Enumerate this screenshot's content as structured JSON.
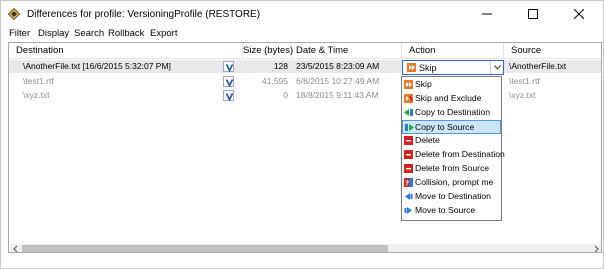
{
  "window": {
    "title": "Differences for profile: VersioningProfile (RESTORE)"
  },
  "menu": [
    "Filter",
    "Display",
    "Search",
    "Rollback",
    "Export"
  ],
  "columns": [
    "Destination",
    "Size (bytes)",
    "Date & Time",
    "Action",
    "Source"
  ],
  "rows": [
    {
      "destination": "\\AnotherFile.txt [16/6/2015 5:32:07 PM]",
      "badge": "V",
      "size": "128",
      "date": "23/5/2015 8:23:09 AM",
      "action": "Skip",
      "source": "\\AnotherFile.txt",
      "muted": false,
      "selected": true
    },
    {
      "destination": "\\test1.rtf",
      "badge": "V",
      "size": "41,595",
      "date": "6/8/2015 10:27:49 AM",
      "action": "",
      "source": "\\test1.rtf",
      "muted": true,
      "selected": false
    },
    {
      "destination": "\\xyz.txt",
      "badge": "V",
      "size": "0",
      "date": "18/8/2015 9:11:43 AM",
      "action": "",
      "source": "\\xyz.txt",
      "muted": true,
      "selected": false
    }
  ],
  "action_combo": {
    "value": "Skip",
    "icon": "skip-icon"
  },
  "action_options": [
    {
      "label": "Skip",
      "icon": "skip-icon"
    },
    {
      "label": "Skip and Exclude",
      "icon": "skip-exclude-icon"
    },
    {
      "label": "Copy to Destination",
      "icon": "copy-to-destination-icon"
    },
    {
      "label": "Copy to Source",
      "icon": "copy-to-source-icon",
      "highlighted": true
    },
    {
      "label": "Delete",
      "icon": "delete-icon"
    },
    {
      "label": "Delete from Destination",
      "icon": "delete-from-destination-icon"
    },
    {
      "label": "Delete from Source",
      "icon": "delete-from-source-icon"
    },
    {
      "label": "Collision, prompt me",
      "icon": "collision-icon"
    },
    {
      "label": "Move to Destination",
      "icon": "move-to-destination-icon"
    },
    {
      "label": "Move to Source",
      "icon": "move-to-source-icon"
    }
  ],
  "colors": {
    "accent": "#2a6bd0",
    "highlight_bg": "#cde6f7",
    "highlight_border": "#4a9ae0",
    "muted_text": "#8c8c8c",
    "selected_row": "#e9e9e9",
    "skip_orange": "#e8792b",
    "delete_red": "#d32020",
    "copy_green": "#22a33a",
    "copy_blue": "#2a7bd8"
  }
}
